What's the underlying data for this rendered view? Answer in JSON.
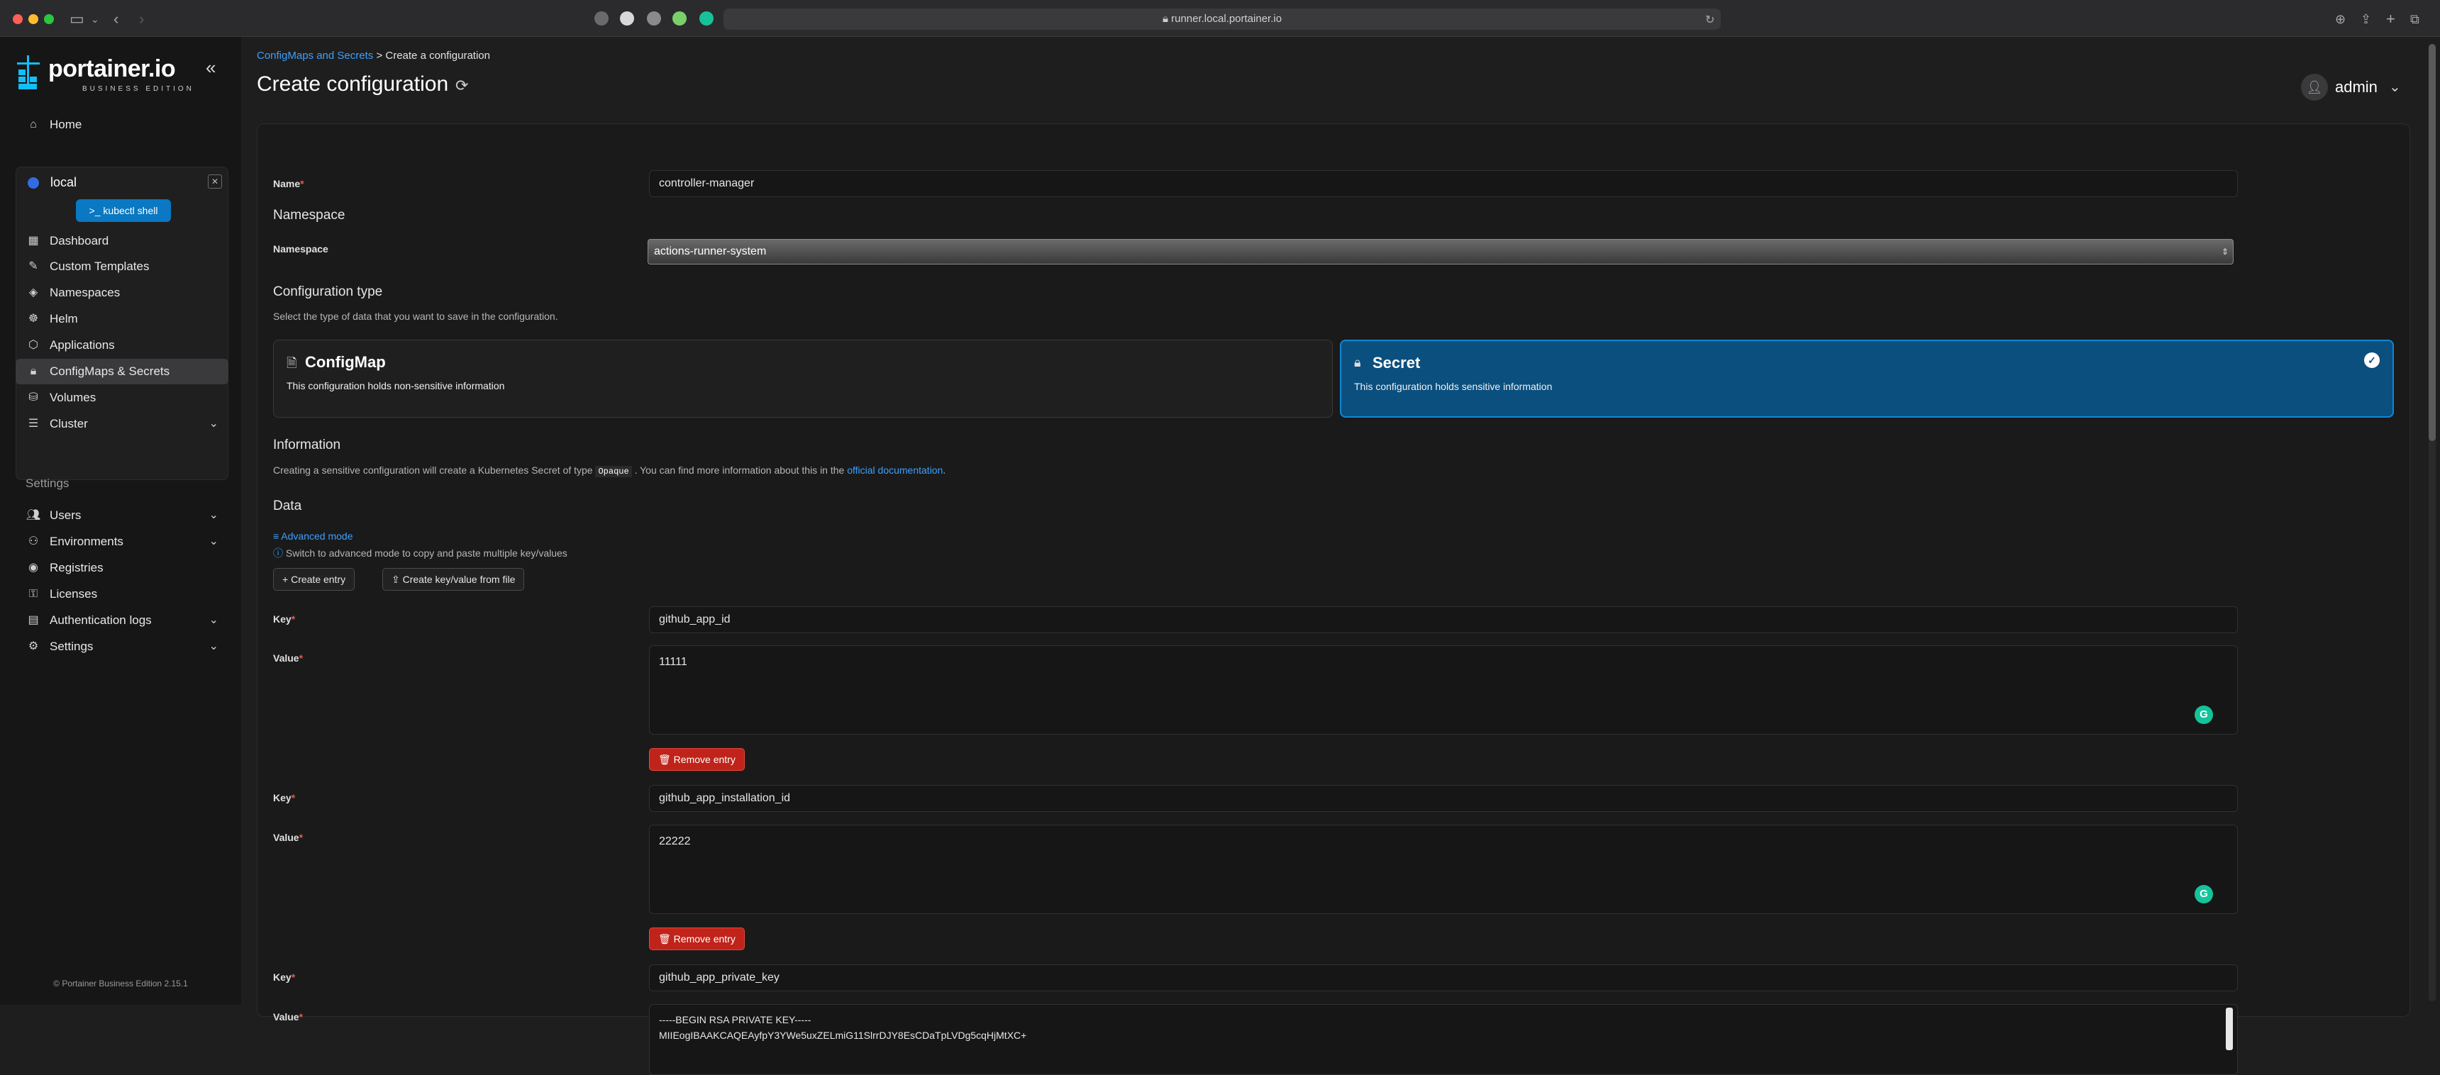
{
  "browser": {
    "url": "runner.local.portainer.io"
  },
  "sidebar": {
    "logo_text": "portainer.io",
    "logo_sub": "BUSINESS EDITION",
    "home": "Home",
    "environment": {
      "name": "local",
      "kubectl_label": "kubectl shell",
      "items": [
        {
          "label": "Dashboard",
          "icon": "dashboard-icon"
        },
        {
          "label": "Custom Templates",
          "icon": "edit-icon"
        },
        {
          "label": "Namespaces",
          "icon": "layers-icon"
        },
        {
          "label": "Helm",
          "icon": "helm-icon"
        },
        {
          "label": "Applications",
          "icon": "box-icon"
        },
        {
          "label": "ConfigMaps & Secrets",
          "icon": "lock-icon"
        },
        {
          "label": "Volumes",
          "icon": "database-icon"
        },
        {
          "label": "Cluster",
          "icon": "server-icon"
        }
      ]
    },
    "settings_title": "Settings",
    "settings_items": [
      {
        "label": "Users"
      },
      {
        "label": "Environments"
      },
      {
        "label": "Registries"
      },
      {
        "label": "Licenses"
      },
      {
        "label": "Authentication logs"
      },
      {
        "label": "Settings"
      }
    ],
    "footer": "© Portainer Business Edition 2.15.1"
  },
  "header": {
    "breadcrumb_link": "ConfigMaps and Secrets",
    "breadcrumb_sep": ">",
    "breadcrumb_current": "Create a configuration",
    "title": "Create configuration",
    "user": "admin"
  },
  "form": {
    "name_label": "Name",
    "name_value": "controller-manager",
    "namespace_section": "Namespace",
    "namespace_label": "Namespace",
    "namespace_value": "actions-runner-system",
    "config_type_section": "Configuration type",
    "config_type_sub": "Select the type of data that you want to save in the configuration.",
    "configmap_title": "ConfigMap",
    "configmap_desc": "This configuration holds non-sensitive information",
    "secret_title": "Secret",
    "secret_desc": "This configuration holds sensitive information",
    "information_section": "Information",
    "info_pre": "Creating a sensitive configuration will create a Kubernetes Secret of type",
    "info_code": "Opaque",
    "info_mid": ". You can find more information about this in the",
    "info_link": "official documentation",
    "info_post": ".",
    "data_section": "Data",
    "advanced_mode": "Advanced mode",
    "advanced_hint": "Switch to advanced mode to copy and paste multiple key/values",
    "create_entry": "Create entry",
    "create_from_file": "Create key/value from file",
    "key_label": "Key",
    "value_label": "Value",
    "remove_entry": "Remove entry",
    "entries": [
      {
        "key": "github_app_id",
        "value": "11111"
      },
      {
        "key": "github_app_installation_id",
        "value": "22222"
      },
      {
        "key": "github_app_private_key",
        "value_line1": "-----BEGIN RSA PRIVATE KEY-----",
        "value_line2": "MIIEogIBAAKCAQEAyfpY3YWe5uxZELmiG11SlrrDJY8EsCDaTpLVDg5cqHjMtXC+"
      }
    ]
  }
}
